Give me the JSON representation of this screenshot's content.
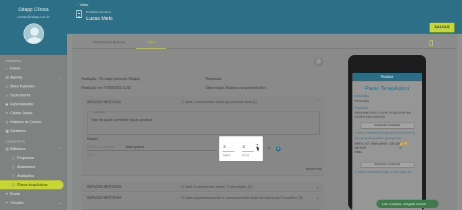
{
  "sidebar": {
    "clinic_name": "Odapp Clínica",
    "email": "contato@odapp.com.br",
    "section_main": "Principal",
    "section_register": "Cadastros",
    "items": [
      {
        "label": "Painel",
        "icon": "home-icon"
      },
      {
        "label": "Agenda",
        "icon": "calendar-icon"
      },
      {
        "label": "Meus Pacientes",
        "icon": "users-icon"
      },
      {
        "label": "Supervisores",
        "icon": "users-icon"
      },
      {
        "label": "Especialidades",
        "icon": "tag-icon"
      },
      {
        "label": "Coletar Dados",
        "icon": "edit-icon"
      },
      {
        "label": "Histórico de Coletas",
        "icon": "history-icon"
      },
      {
        "label": "Relatórios",
        "icon": "report-icon"
      }
    ],
    "library": {
      "label": "Biblioteca",
      "icon": "book-icon"
    },
    "sub_items": [
      {
        "label": "Programas",
        "icon": "file-icon"
      },
      {
        "label": "Anamneses",
        "icon": "file-icon"
      },
      {
        "label": "Avaliações",
        "icon": "file-icon"
      },
      {
        "label": "Planos terapêuticos",
        "icon": "file-icon"
      }
    ],
    "bottom_items": [
      {
        "label": "Enviar",
        "icon": "send-icon"
      },
      {
        "label": "Vínculos",
        "icon": "link-icon"
      }
    ]
  },
  "header": {
    "back_label": "Voltar",
    "subtitle": "Detalhes do plano",
    "title": "Lucas Melo",
    "save_label": "SALVAR"
  },
  "tabs": [
    "Informações Básicas",
    "Plano"
  ],
  "meta": {
    "evaluation": "Avaliação: VS mapp (exemplo Odapp)",
    "therapist": "Terapeuta:",
    "done_at": "Realizado em: 07/08/2023 11:52",
    "observation": "Observação: Estamos progredindo bem"
  },
  "rows": [
    {
      "title": "IMITACAO MOTORA2",
      "desc": "2. Imita 4 movimentos motor grosso com itens (1)"
    },
    {
      "title": "IMITACAO MOTORA3",
      "desc": "3. Imita 8 movimentos motor, 2 com objeto. (1)"
    },
    {
      "title": "IMITACAO MOTORA4",
      "desc": "4. Imita espontaneamente o comportamento motor de outros em 5 ocasiões (3)"
    }
  ],
  "suggestion": {
    "legend": "Sugestão",
    "text": "Tipo de ajuda permitido: Ajuda gestual"
  },
  "steps": {
    "label": "Etapas:",
    "item_label": "IMITACAO MOTOR",
    "item_value": "bater palma",
    "meta_value": "3",
    "meta_label": "Meta",
    "cycle_value": "6",
    "cycle_label": "Ciclo",
    "remove_label": "REMOVER"
  },
  "phone": {
    "header": "Realizar",
    "title": "Plano Terapêutico",
    "description_label": "Descrição",
    "description_value": "Pé escolar",
    "purpose_label": "Proposta",
    "purpose_value": "Seja preenchido o nome do paciente que receber este exercício",
    "block1": "Imitacao motora2",
    "block1_note": "2. Imita 4 movimentos motor grosso com itens (1)",
    "block1_help": "Tipo de ajuda permitido: Ajuda gestual",
    "row_a": "IMITACAO MOTOR A2E1",
    "row_b": "bater palma",
    "row_c": "3/6 cpfs",
    "block2": "Imitacao motora3",
    "block2_note": "3. Imita 8 movimentos motor, 2 com objeto. (1)"
  },
  "toast": "Lote completo, obrigado sensor!"
}
